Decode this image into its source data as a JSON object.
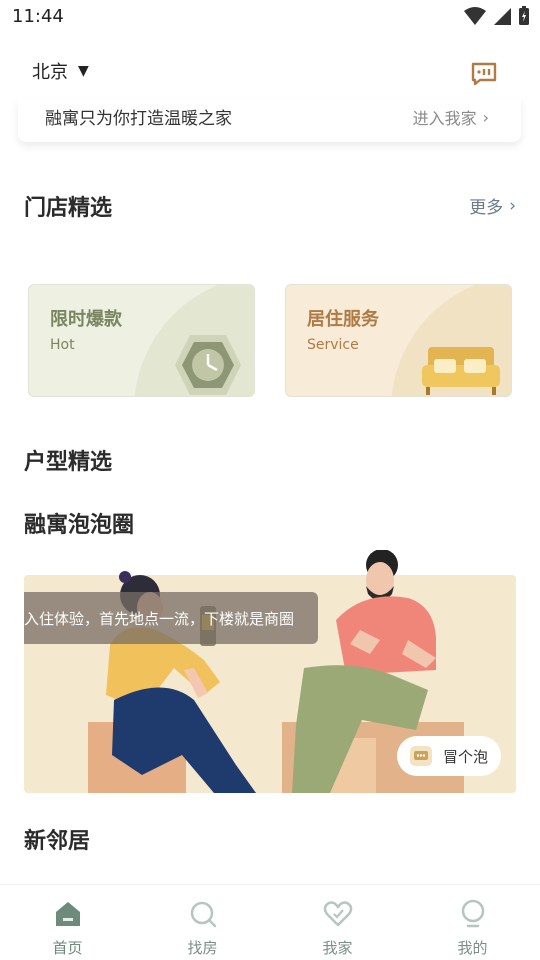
{
  "status_bar": {
    "time": "11:44"
  },
  "header": {
    "city": "北京",
    "message_icon": "chat-bubble-icon"
  },
  "welcome": {
    "text": "融寓只为你打造温暖之家",
    "enter_link": "进入我家"
  },
  "sections": {
    "stores": {
      "title": "门店精选",
      "more": "更多"
    },
    "layouts": {
      "title": "户型精选"
    },
    "bubbles": {
      "title": "融寓泡泡圈"
    },
    "neighbors": {
      "title": "新邻居"
    }
  },
  "promo_cards": [
    {
      "title": "限时爆款",
      "subtitle": "Hot",
      "icon": "clock-icon",
      "title_color": "#7b8560",
      "bg": "#eef0e2"
    },
    {
      "title": "居住服务",
      "subtitle": "Service",
      "icon": "sofa-icon",
      "title_color": "#b07a45",
      "bg": "#f8ecd8"
    }
  ],
  "bubble_banner": {
    "ticker": "入住体验，首先地点一流，下楼就是商圈",
    "button_label": "冒个泡"
  },
  "bottom_nav": [
    {
      "label": "首页",
      "icon": "home-icon",
      "active": true
    },
    {
      "label": "找房",
      "icon": "search-icon",
      "active": false
    },
    {
      "label": "我家",
      "icon": "heart-icon",
      "active": false
    },
    {
      "label": "我的",
      "icon": "profile-icon",
      "active": false
    }
  ],
  "colors": {
    "accent": "#6d8a7a",
    "brand_gold": "#c9a35a"
  }
}
